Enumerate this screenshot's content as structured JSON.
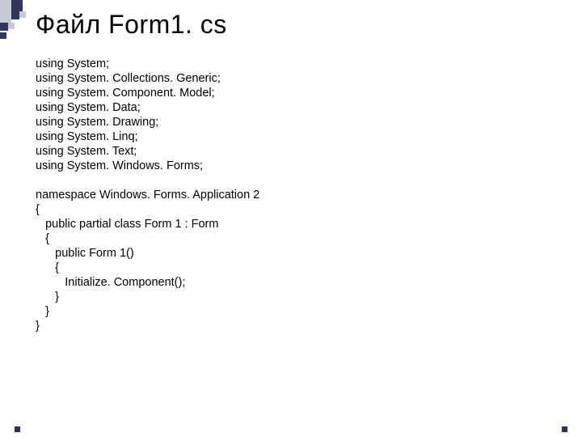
{
  "title": "Файл Form1. cs",
  "code_lines": [
    "using System;",
    "using System. Collections. Generic;",
    "using System. Component. Model;",
    "using System. Data;",
    "using System. Drawing;",
    "using System. Linq;",
    "using System. Text;",
    "using System. Windows. Forms;",
    "",
    "namespace Windows. Forms. Application 2",
    "{",
    "   public partial class Form 1 : Form",
    "   {",
    "      public Form 1()",
    "      {",
    "         Initialize. Component();",
    "      }",
    "   }",
    "}"
  ]
}
